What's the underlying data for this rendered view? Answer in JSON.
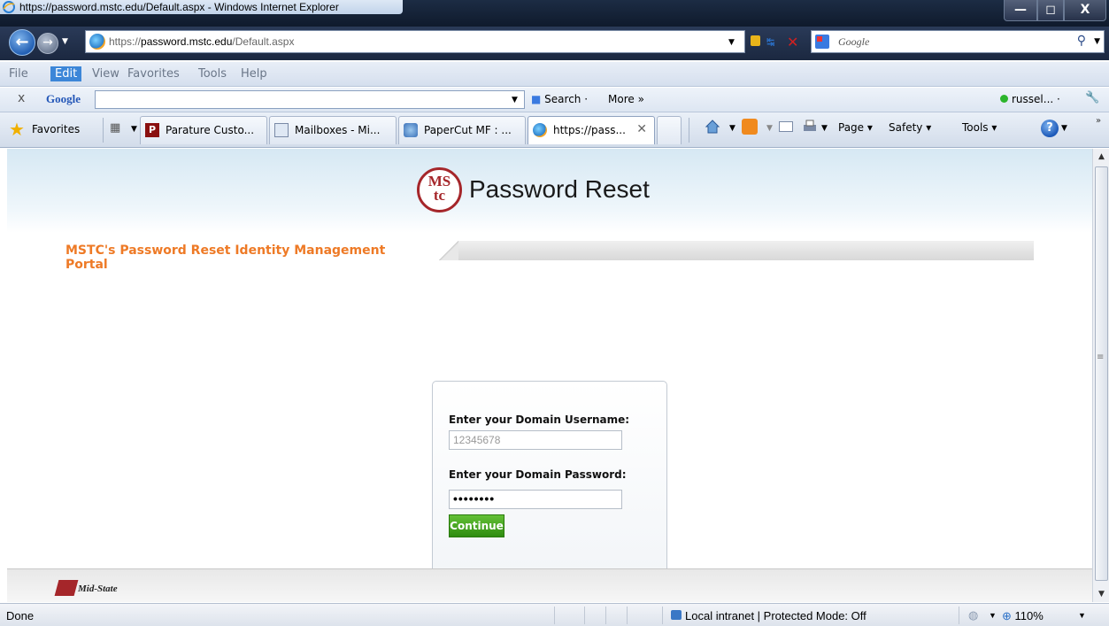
{
  "window": {
    "title": "https://password.mstc.edu/Default.aspx - Windows Internet Explorer",
    "min_glyph": "—",
    "max_glyph": "◻",
    "close_glyph": "X"
  },
  "address": {
    "url_host_prefix": "https://",
    "url_host": "password.mstc.edu",
    "url_path": "/Default.aspx",
    "search_placeholder": "Google"
  },
  "menu": {
    "items": [
      "File",
      "Edit",
      "View",
      "Favorites",
      "Tools",
      "Help"
    ],
    "active": "Edit"
  },
  "google_toolbar": {
    "close": "x",
    "logo": "Google",
    "search_label": "Search ·",
    "more_label": "More »",
    "user": "russel... ·"
  },
  "favorites": {
    "label": "Favorites",
    "tabs": [
      {
        "label": "Parature Custo...",
        "icon": "parature-icon"
      },
      {
        "label": "Mailboxes - Mi...",
        "icon": "mailbox-icon"
      },
      {
        "label": "PaperCut MF : ...",
        "icon": "papercut-icon"
      },
      {
        "label": "https://pass...",
        "icon": "site-icon",
        "close": "✕"
      }
    ],
    "commands": {
      "page": "Page ▾",
      "safety": "Safety ▾",
      "tools": "Tools ▾",
      "help": "?"
    }
  },
  "page": {
    "logo_line1": "MS",
    "logo_line2": "tc",
    "logo_title": "Password Reset",
    "portal_title": "MSTC's Password Reset Identity Management Portal",
    "username_label": "Enter your Domain Username:",
    "username_value": "12345678",
    "password_label": "Enter your Domain Password:",
    "password_value": "••••••••",
    "continue_label": "Continue",
    "footer_brand": "Mid-State"
  },
  "status": {
    "text": "Done",
    "zone": "Local intranet | Protected Mode: Off",
    "zoom": "110%"
  },
  "colors": {
    "accent_orange": "#ee7a26",
    "logo_red": "#a5262a",
    "button_green": "#3f9c1c"
  }
}
